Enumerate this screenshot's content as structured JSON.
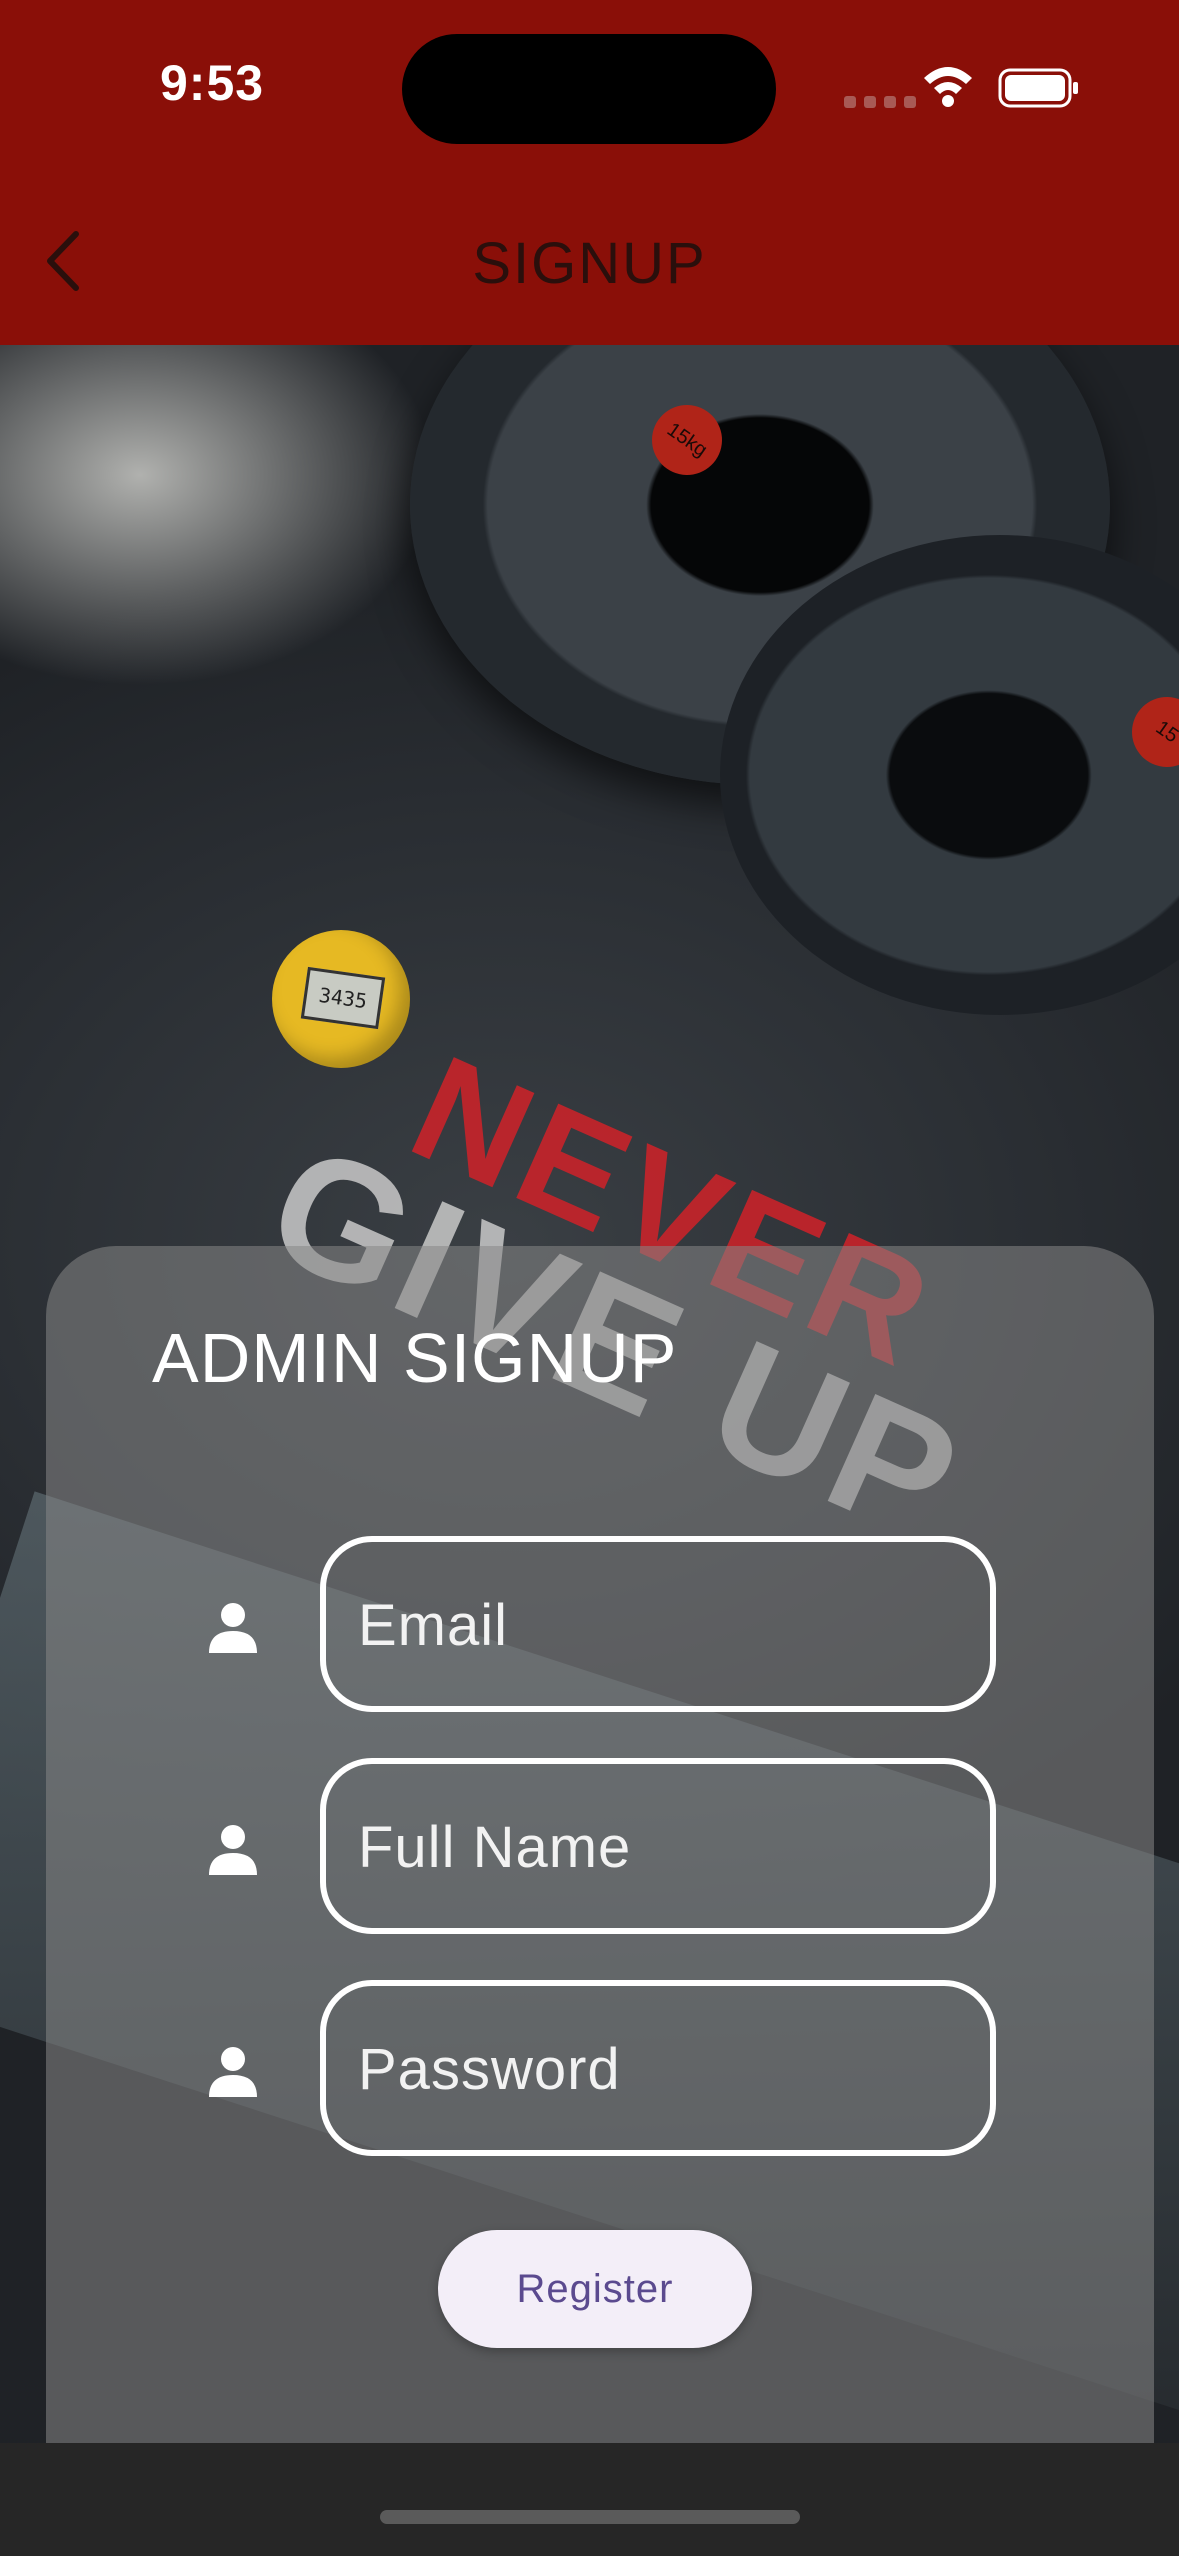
{
  "status_bar": {
    "time": "9:53",
    "icons": [
      "cellular-signal-icon",
      "wifi-icon",
      "battery-icon"
    ]
  },
  "app_bar": {
    "title": "SIGNUP",
    "back_icon": "chevron-left-icon",
    "background_color": "#8a0f08"
  },
  "background_photo": {
    "plate_tag": "15kg",
    "plate_tag_partial": "15",
    "stopwatch_display": "3435",
    "slogan_line1": "NEVER",
    "slogan_line2": "GIVE UP"
  },
  "form": {
    "title": "ADMIN SIGNUP",
    "fields": [
      {
        "placeholder": "Email",
        "icon": "person-icon"
      },
      {
        "placeholder": "Full Name",
        "icon": "person-icon"
      },
      {
        "placeholder": "Password",
        "icon": "person-icon"
      }
    ],
    "register_label": "Register",
    "register_text_color": "#5b4a8f"
  }
}
